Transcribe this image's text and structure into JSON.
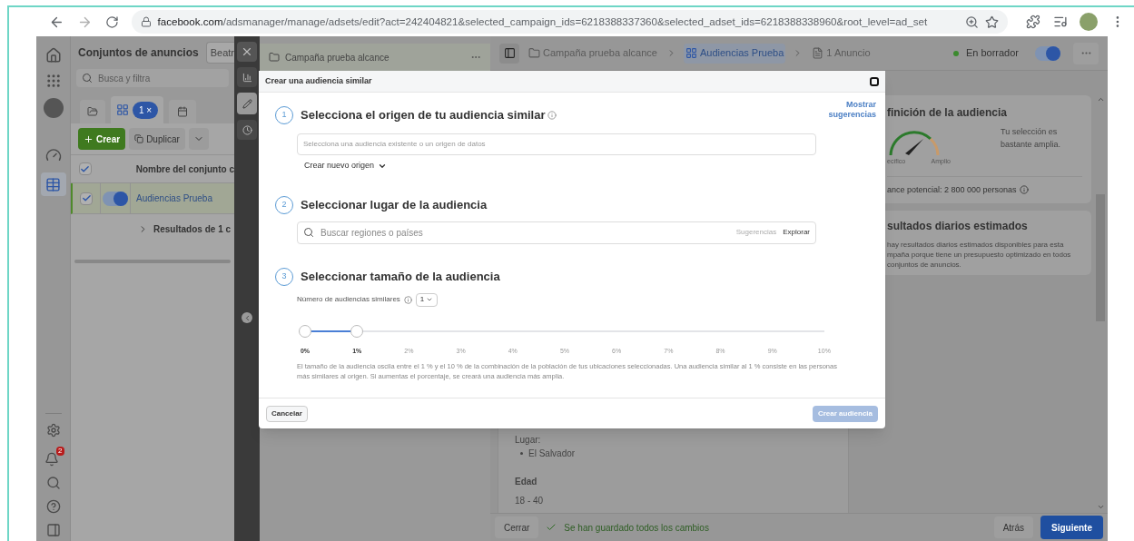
{
  "browser": {
    "host": "facebook.com",
    "path": "/adsmanager/manage/adsets/edit?act=242404821&selected_campaign_ids=6218388337360&selected_adset_ids=6218388338960&root_level=ad_set"
  },
  "nav_rail": {
    "notification_count": "2"
  },
  "adsets_panel": {
    "title": "Conjuntos de anuncios",
    "account_button": "Beatr",
    "search_placeholder": "Busca y filtra",
    "filter_chip": "1 ×",
    "create_button": "Crear",
    "duplicate_button": "Duplicar",
    "table": {
      "header": "Nombre del conjunto c",
      "header_checked": true,
      "rows": [
        {
          "name": "Audiencias Prueba",
          "checked": true,
          "on": true,
          "selected": true
        }
      ],
      "results_row": "Resultados de 1 c"
    }
  },
  "tree_panel": {
    "campaign": "Campaña prueba alcance"
  },
  "breadcrumbs": [
    {
      "label": "Campaña prueba alcance",
      "kind": "campaign",
      "selected": false
    },
    {
      "label": "Audiencias Prueba",
      "kind": "adset",
      "selected": true
    },
    {
      "label": "1 Anuncio",
      "kind": "ad",
      "selected": false
    }
  ],
  "status": {
    "label": "En borrador",
    "on": true
  },
  "summary": {
    "place_label": "Lugar:",
    "places": [
      "El Salvador"
    ],
    "age_label": "Edad",
    "age": "18 - 40"
  },
  "audience_card": {
    "title": "finición de la audiencia",
    "gauge_left": "ecífico",
    "gauge_right": "Amplio",
    "note": "Tu selección es bastante amplia.",
    "reach": "ance potencial: 2 800 000 personas"
  },
  "results_card": {
    "title": "sultados diarios estimados",
    "lines": [
      "hay resultados diarios estimados disponibles para esta",
      "mpaña porque tiene un presupuesto optimizado en todos",
      "conjuntos de anuncios."
    ]
  },
  "footer": {
    "close": "Cerrar",
    "saved": "Se han guardado todos los cambios",
    "back": "Atrás",
    "next": "Siguiente"
  },
  "modal": {
    "title": "Crear una audiencia similar",
    "suggestions_link": "Mostrar sugerencias",
    "steps": [
      {
        "kind": "source",
        "number": "1",
        "title": "Selecciona el origen de tu audiencia similar",
        "info": true,
        "placeholder": "Selecciona una audiencia existente o un origen de datos",
        "menu": "Crear nuevo origen"
      },
      {
        "kind": "location",
        "number": "2",
        "title": "Seleccionar lugar de la audiencia",
        "placeholder": "Buscar regiones o países",
        "suggestions": "Sugerencias",
        "explore": "Explorar"
      },
      {
        "kind": "size",
        "number": "3",
        "title": "Seleccionar tamaño de la audiencia",
        "count_label": "Número de audiencias similares",
        "count": "1",
        "slider": {
          "level": 0.1,
          "ticks": [
            {
              "label": "0%",
              "selected": true
            },
            {
              "label": "1%",
              "selected": true
            },
            {
              "label": "2%",
              "selected": false
            },
            {
              "label": "3%",
              "selected": false
            },
            {
              "label": "4%",
              "selected": false
            },
            {
              "label": "5%",
              "selected": false
            },
            {
              "label": "6%",
              "selected": false
            },
            {
              "label": "7%",
              "selected": false
            },
            {
              "label": "8%",
              "selected": false
            },
            {
              "label": "9%",
              "selected": false
            },
            {
              "label": "10%",
              "selected": false
            }
          ]
        },
        "description": "El tamaño de la audiencia oscila entre el 1 % y el 10 % de la combinación de la población de tus ubicaciones seleccionadas. Una audiencia similar al 1 % consiste en las personas más similares al origen. Si aumentas el porcentaje, se creará una audiencia más amplia."
      }
    ],
    "cancel": "Cancelar",
    "create": "Crear audiencia",
    "create_disabled": true
  }
}
